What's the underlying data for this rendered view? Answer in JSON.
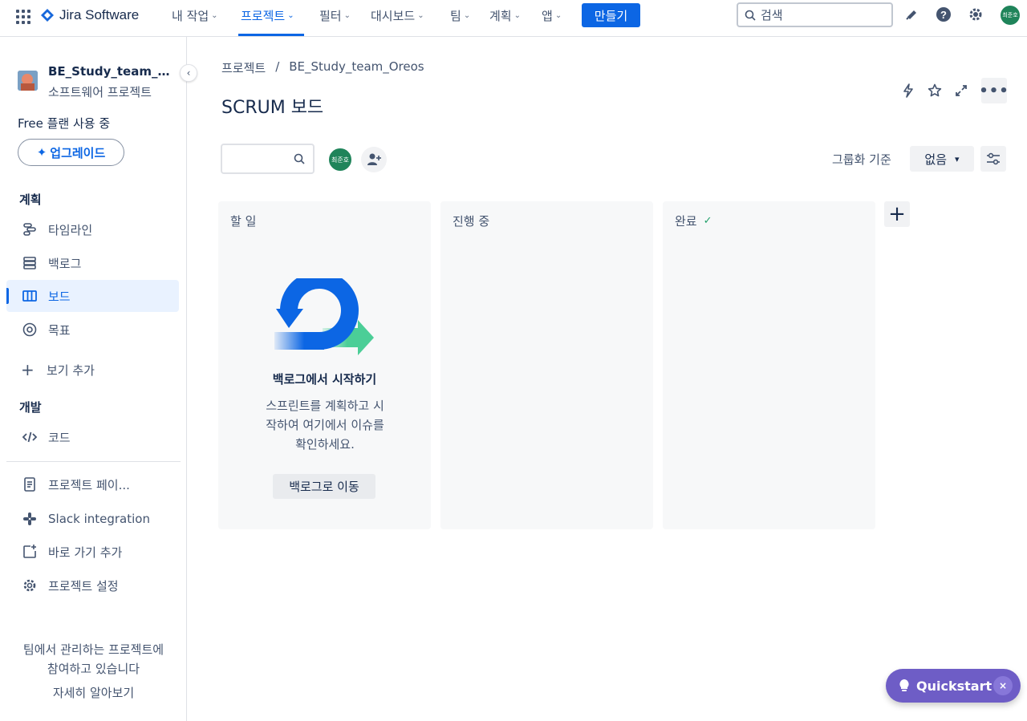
{
  "topbar": {
    "app_name": "Jira Software",
    "nav": [
      {
        "label": "내 작업"
      },
      {
        "label": "프로젝트"
      },
      {
        "label": "필터"
      },
      {
        "label": "대시보드"
      },
      {
        "label": "팀"
      },
      {
        "label": "계획"
      },
      {
        "label": "앱"
      }
    ],
    "create_label": "만들기",
    "search_placeholder": "검색",
    "avatar_text": "최준호",
    "icons": [
      "app-switcher-icon",
      "jira-logo-icon",
      "notifications-icon",
      "help-icon",
      "settings-icon"
    ]
  },
  "sidebar": {
    "project_name": "BE_Study_team_Or...",
    "project_type": "소프트웨어 프로젝트",
    "plan_text": "Free 플랜 사용 중",
    "upgrade_label": "업그레이드",
    "section_plan": "계획",
    "section_dev": "개발",
    "items": [
      {
        "label": "타임라인",
        "icon": "timeline-icon"
      },
      {
        "label": "백로그",
        "icon": "backlog-icon"
      },
      {
        "label": "보드",
        "icon": "board-icon",
        "active": true
      },
      {
        "label": "목표",
        "icon": "goals-icon"
      },
      {
        "label": "보기 추가",
        "icon": "plus-icon"
      },
      {
        "label": "코드",
        "icon": "code-icon"
      },
      {
        "label": "프로젝트 페이...",
        "icon": "page-icon"
      },
      {
        "label": "Slack integration",
        "icon": "slack-icon"
      },
      {
        "label": "바로 가기 추가",
        "icon": "add-shortcut-icon"
      },
      {
        "label": "프로젝트 설정",
        "icon": "settings-icon"
      }
    ],
    "team_note_line1": "팀에서 관리하는 프로젝트에",
    "team_note_line2": "참여하고 있습니다",
    "learn_more": "자세히 알아보기"
  },
  "main": {
    "breadcrumb_root": "프로젝트",
    "breadcrumb_sep": "/",
    "breadcrumb_project": "BE_Study_team_Oreos",
    "title": "SCRUM 보드",
    "user_avatar_text": "최준호",
    "group_by_label": "그룹화 기준",
    "group_by_value": "없음",
    "columns": [
      {
        "title": "할 일"
      },
      {
        "title": "진행 중"
      },
      {
        "title": "완료",
        "done": true
      }
    ],
    "empty_state": {
      "title": "백로그에서 시작하기",
      "desc_line1": "스프린트를 계획하고 시",
      "desc_line2": "작하여 여기에서 이슈를",
      "desc_line3": "확인하세요.",
      "button": "백로그로 이동"
    }
  },
  "quickstart": {
    "label": "Quickstart",
    "close": "×"
  },
  "colors": {
    "brand": "#0c66e4",
    "avatar": "#1f845a",
    "quickstart": "#6e5dc6",
    "done": "#22a06b"
  }
}
